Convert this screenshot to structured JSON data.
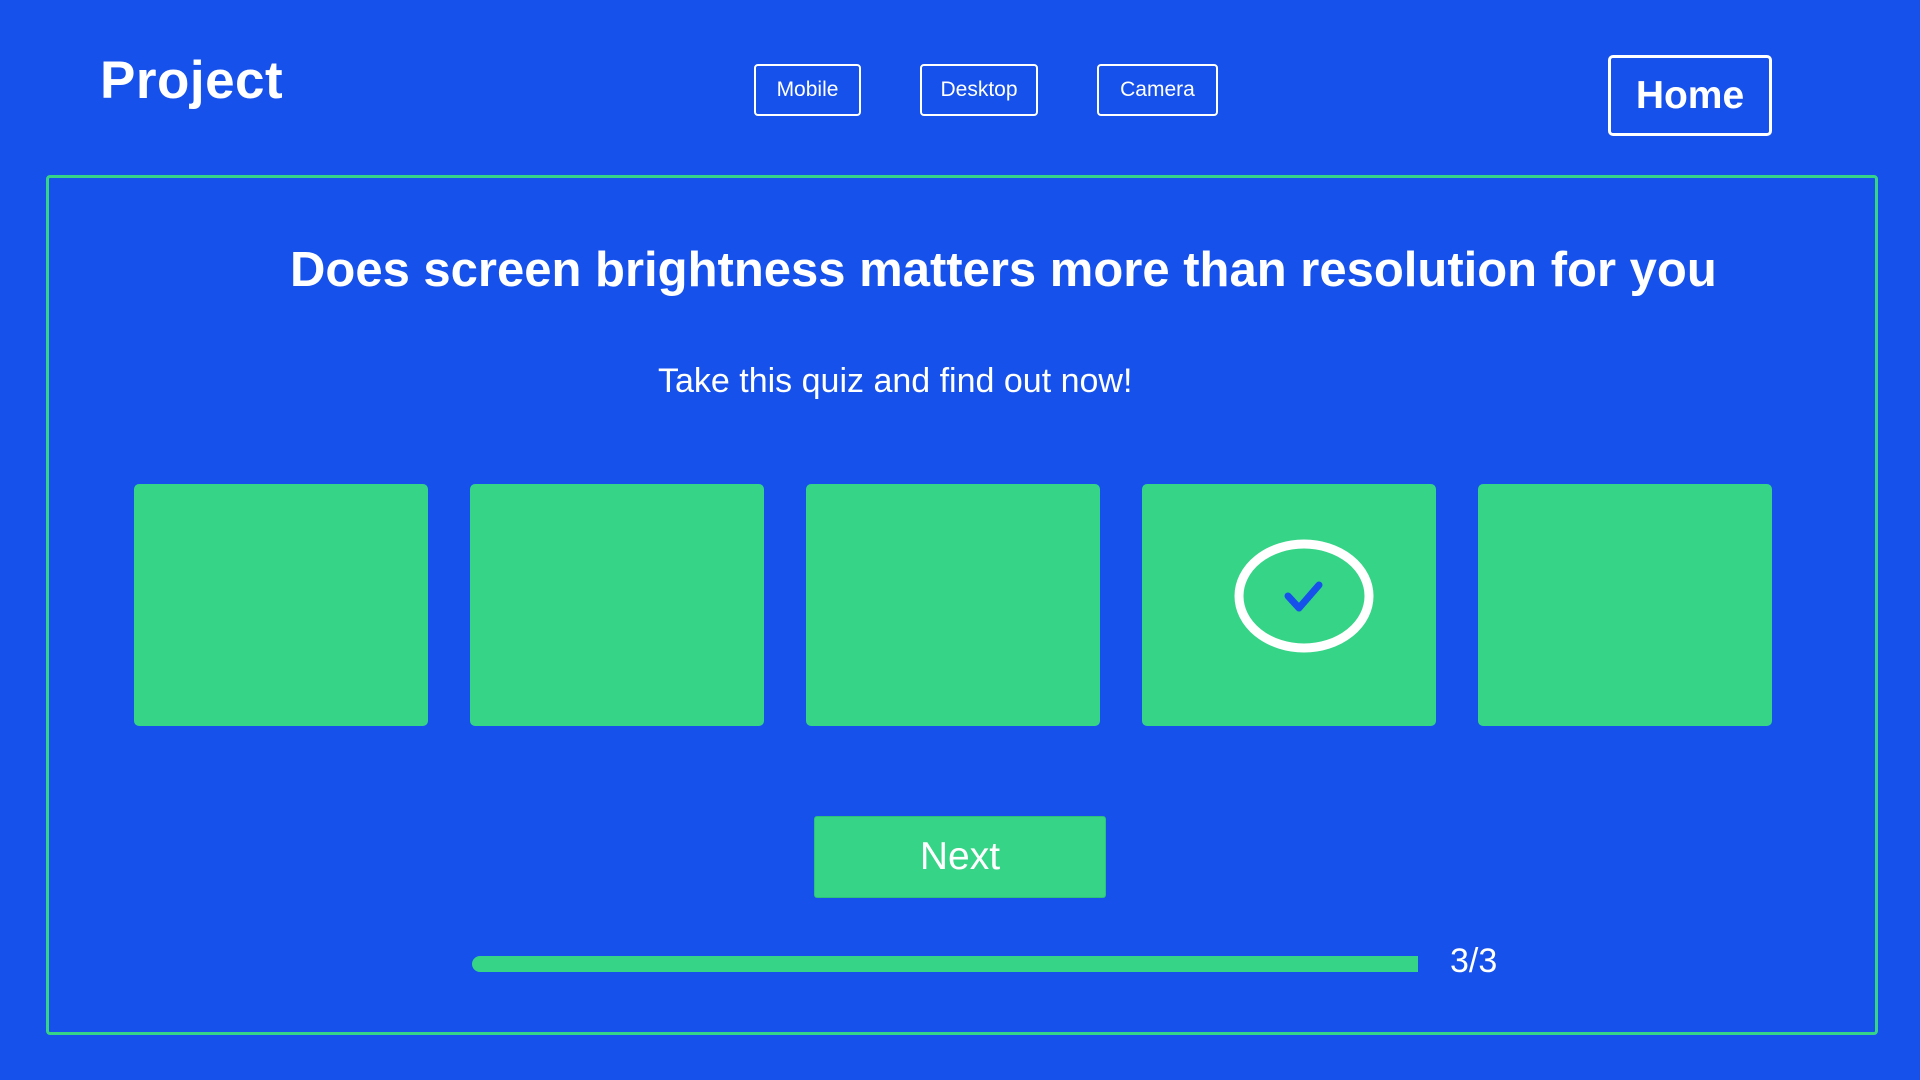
{
  "header": {
    "logo": "Project",
    "nav": [
      {
        "label": "Mobile"
      },
      {
        "label": "Desktop"
      },
      {
        "label": "Camera"
      }
    ],
    "home_label": "Home"
  },
  "quiz": {
    "question": "Does screen brightness matters more than resolution for you",
    "subtitle": "Take this quiz and find out now!",
    "options_count": 5,
    "selected_option": 4,
    "selected_icon": "check-circle-icon",
    "next_label": "Next",
    "progress": {
      "current": 3,
      "total": 3,
      "fraction": 1.0,
      "label": "3/3"
    }
  },
  "colors": {
    "background": "#1651ec",
    "accent": "#36d487",
    "text": "#ffffff"
  }
}
